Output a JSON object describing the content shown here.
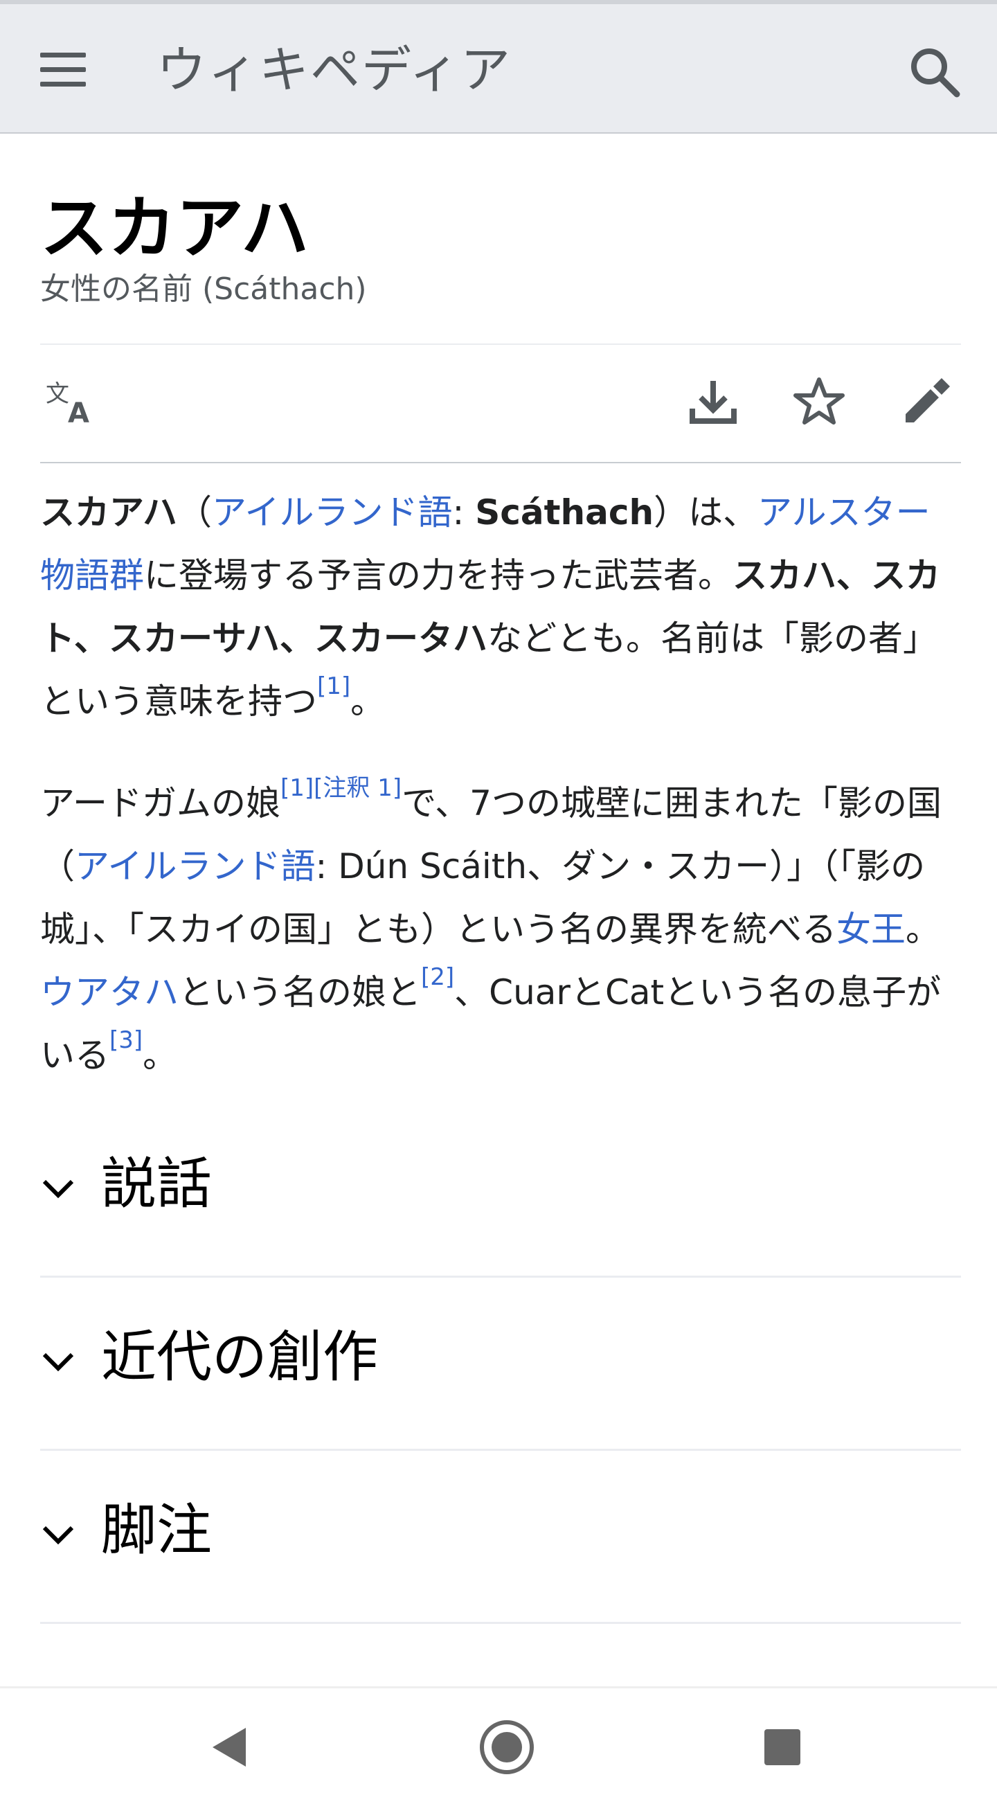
{
  "header": {
    "wordmark": "ウィキペディア",
    "menu_icon": "hamburger-menu-icon",
    "search_icon": "search-icon"
  },
  "page": {
    "title": "スカアハ",
    "subtitle": "女性の名前 (Scáthach)"
  },
  "actions": {
    "language_icon": "language-icon",
    "download_icon": "download-icon",
    "watch_icon": "star-icon",
    "edit_icon": "pencil-icon"
  },
  "paragraph1": {
    "bold_name": "スカアハ",
    "open_paren": "（",
    "irish_link": "アイルランド語",
    "colon": ": ",
    "bold_irish": "Scáthach",
    "after_irish": "）は、",
    "ulster_link": "アルスター物語群",
    "text1": "に登場する予言の力を持った武芸者。",
    "bold_aliases": "スカハ、スカト、スカーサハ、スカータハ",
    "text2": "などとも。名前は「影の者」という意味を持つ",
    "ref1": "[1]",
    "end": "。"
  },
  "paragraph2": {
    "text1": "アードガムの娘",
    "ref1": "[1]",
    "note1": "[注釈 1]",
    "text2": "で、7つの城壁に囲まれた「影の国（",
    "irish_link": "アイルランド語",
    "text3": ": Dún Scáith、ダン・スカー）」（「影の城」、「スカイの国」とも）という名の異界を統べる",
    "queen_link": "女王",
    "text4": "。",
    "uathach_link": "ウアタハ",
    "text5": "という名の娘と",
    "ref2": "[2]",
    "text6": "、CuarとCatという名の息子がいる",
    "ref3": "[3]",
    "end": "。"
  },
  "sections": [
    {
      "label": "説話",
      "icon": "chevron-down-icon"
    },
    {
      "label": "近代の創作",
      "icon": "chevron-down-icon"
    },
    {
      "label": "脚注",
      "icon": "chevron-down-icon"
    }
  ],
  "navbar": {
    "back_icon": "back-triangle-icon",
    "home_icon": "home-circle-icon",
    "recents_icon": "recents-square-icon"
  },
  "colors": {
    "link": "#3366cc",
    "header_bg": "#eaecf0",
    "text": "#202122",
    "muted": "#54595d"
  }
}
